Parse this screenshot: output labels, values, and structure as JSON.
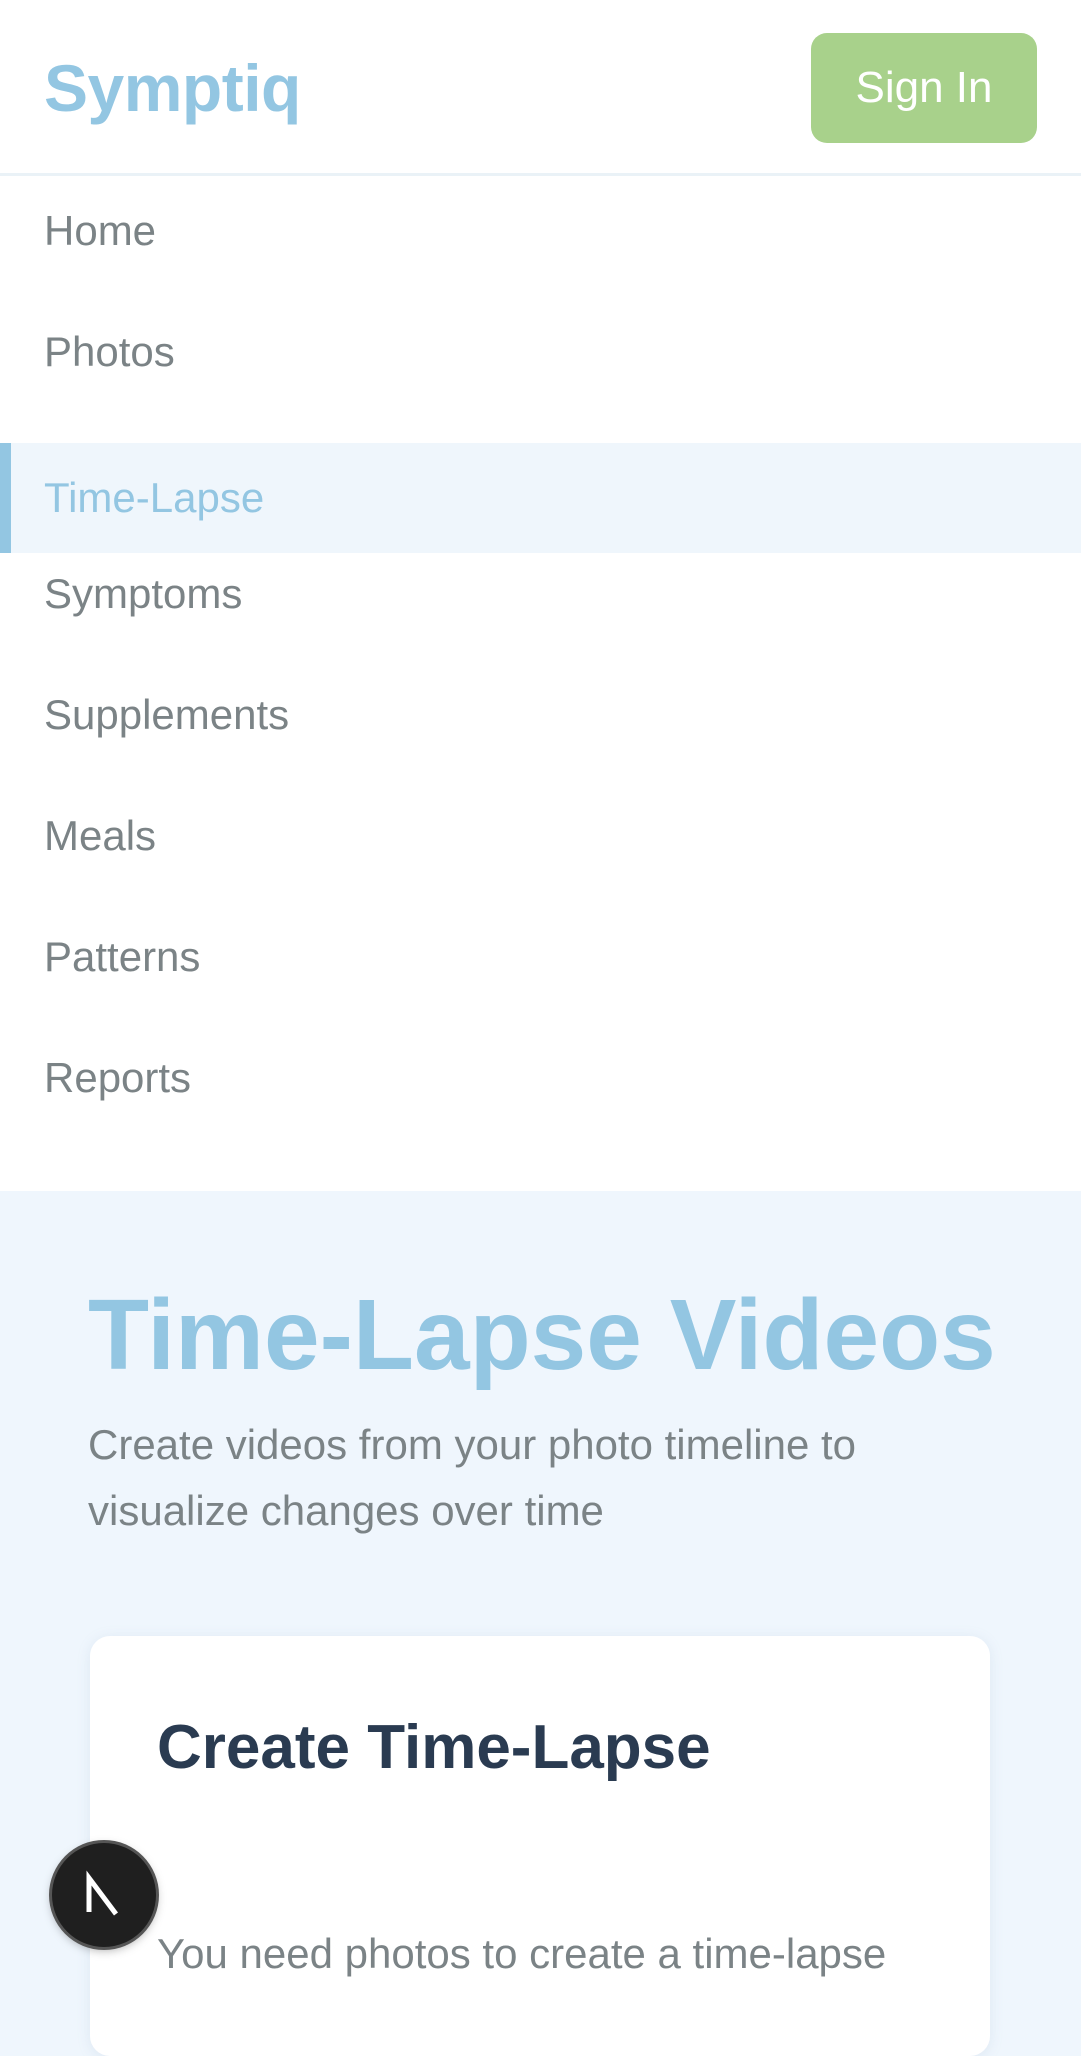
{
  "header": {
    "logo": "Symptiq",
    "sign_in_label": "Sign In"
  },
  "nav": {
    "items": [
      {
        "label": "Home",
        "active": false
      },
      {
        "label": "Photos",
        "active": false
      },
      {
        "label": "Time-Lapse",
        "active": true
      },
      {
        "label": "Symptoms",
        "active": false
      },
      {
        "label": "Supplements",
        "active": false
      },
      {
        "label": "Meals",
        "active": false
      },
      {
        "label": "Patterns",
        "active": false
      },
      {
        "label": "Reports",
        "active": false
      }
    ]
  },
  "hero": {
    "title": "Time-Lapse Videos",
    "subtitle": "Create videos from your photo timeline to visualize changes over time"
  },
  "card": {
    "title": "Create Time-Lapse",
    "text": "You need photos to create a time-lapse"
  },
  "badge": {
    "icon": "nextjs-logo-icon"
  },
  "colors": {
    "brand": "#93c6e2",
    "sign_in": "#a8d18b",
    "page_background": "#eff6fd",
    "heading": "#2a3b51",
    "muted_text": "#7b8386"
  }
}
